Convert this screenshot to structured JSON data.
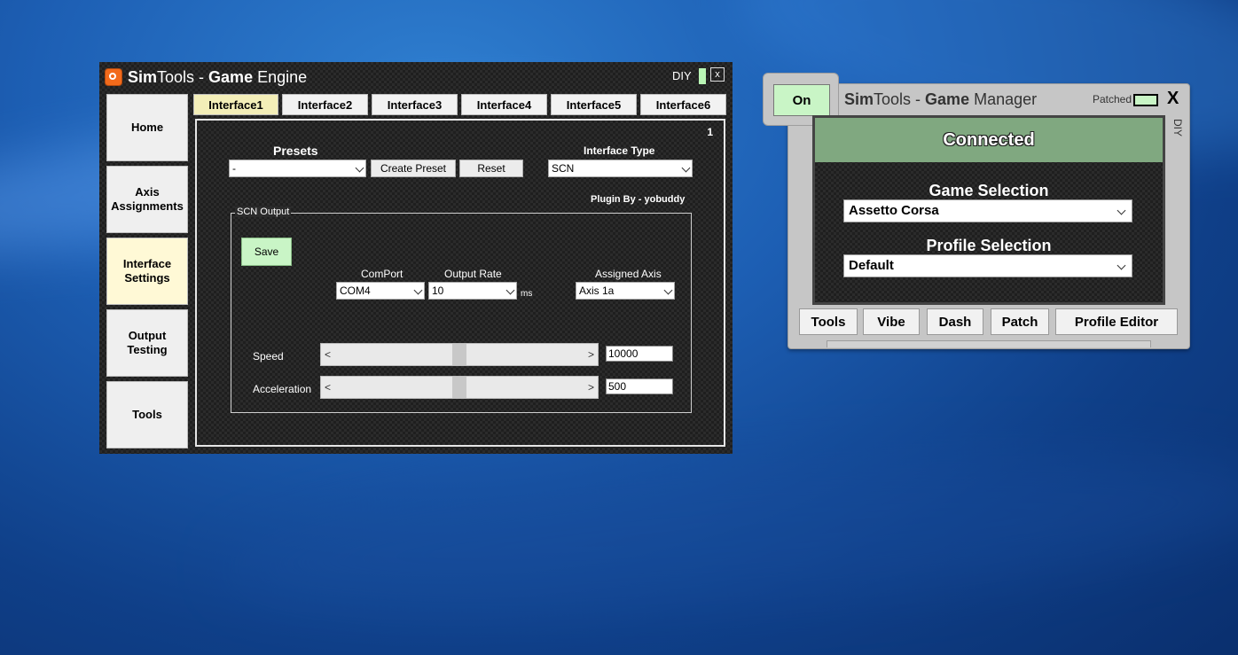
{
  "engine": {
    "title_part1": "Sim",
    "title_part2": "Tools - ",
    "title_part3": "Game",
    "title_part4": " Engine",
    "diy_label": "DIY",
    "close_glyph": "x",
    "nav": {
      "home": "Home",
      "axis_line1": "Axis",
      "axis_line2": "Assignments",
      "interface_line1": "Interface",
      "interface_line2": "Settings",
      "output_line1": "Output",
      "output_line2": "Testing",
      "tools": "Tools"
    },
    "tabs": [
      "Interface1",
      "Interface2",
      "Interface3",
      "Interface4",
      "Interface5",
      "Interface6"
    ],
    "panel": {
      "number": "1",
      "presets_label": "Presets",
      "presets_value": "-",
      "create_preset": "Create Preset",
      "reset": "Reset",
      "interface_type_label": "Interface Type",
      "interface_type_value": "SCN",
      "plugin_by": "Plugin By - yobuddy",
      "group_title": "SCN Output",
      "save": "Save",
      "comport_label": "ComPort",
      "comport_value": "COM4",
      "output_rate_label": "Output Rate",
      "output_rate_value": "10",
      "ms_label": "ms",
      "assigned_axis_label": "Assigned Axis",
      "assigned_axis_value": "Axis 1a",
      "speed_label": "Speed",
      "speed_value": "10000",
      "accel_label": "Acceleration",
      "accel_value": "500",
      "slider_left": "<",
      "slider_right": ">"
    }
  },
  "manager": {
    "on_label": "On",
    "title_part1": "Sim",
    "title_part2": "Tools - ",
    "title_part3": "Game",
    "title_part4": " Manager",
    "patched_label": "Patched",
    "close_glyph": "X",
    "diy_label": "DIY",
    "status": "Connected",
    "game_selection_label": "Game Selection",
    "game_selection_value": "Assetto Corsa",
    "profile_selection_label": "Profile Selection",
    "profile_selection_value": "Default",
    "buttons": {
      "tools": "Tools",
      "vibe": "Vibe",
      "dash": "Dash",
      "patch": "Patch",
      "profile_editor": "Profile Editor"
    }
  }
}
